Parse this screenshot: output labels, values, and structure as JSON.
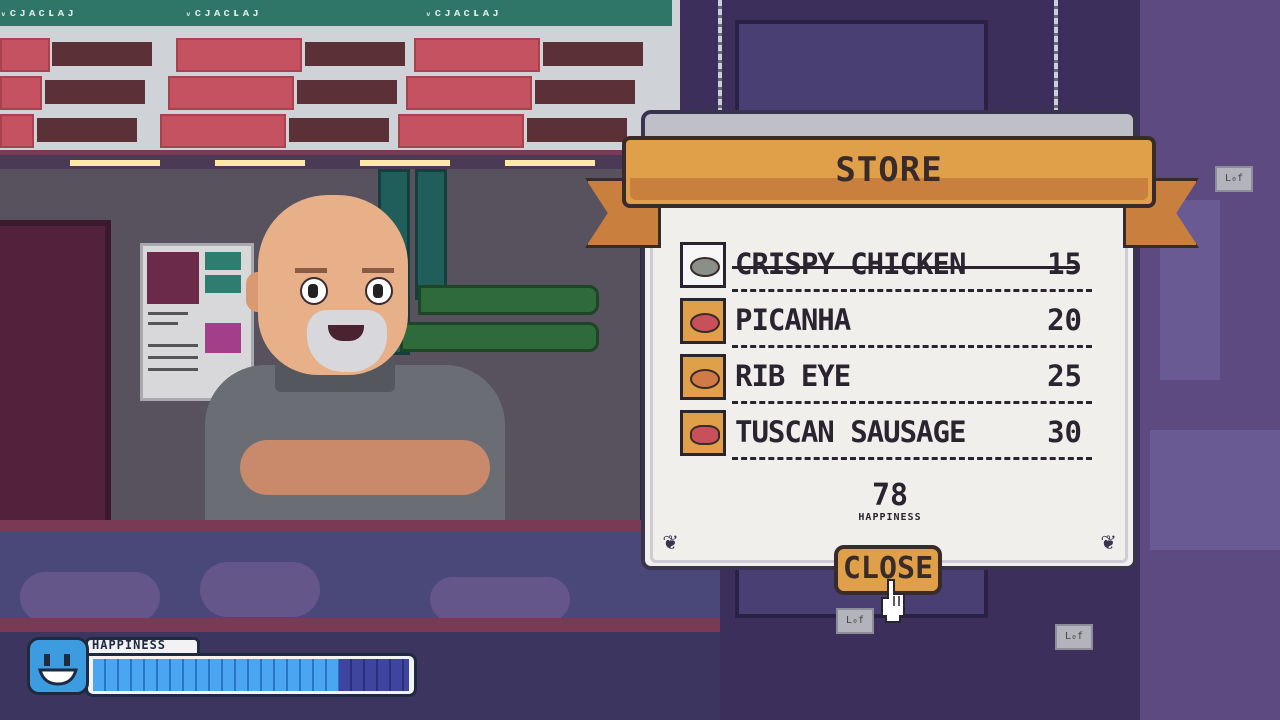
{
  "store": {
    "title": "STORE",
    "items": [
      {
        "name": "CRISPY CHICKEN",
        "price": "15",
        "purchased": true,
        "icon": "fried-chicken-icon",
        "food_color": "#8a8f8a"
      },
      {
        "name": "PICANHA",
        "price": "20",
        "purchased": false,
        "icon": "picanha-steak-icon",
        "food_color": "#c8505a"
      },
      {
        "name": "RIB EYE",
        "price": "25",
        "purchased": false,
        "icon": "rib-eye-steak-icon",
        "food_color": "#d07a45"
      },
      {
        "name": "TUSCAN SAUSAGE",
        "price": "30",
        "purchased": false,
        "icon": "tuscan-sausage-icon",
        "food_color": "#c8505a"
      }
    ],
    "happiness_value": "78",
    "happiness_caption": "HAPPINESS",
    "close_label": "CLOSE"
  },
  "hud": {
    "label": "HAPPINESS",
    "fill_fraction": 0.78,
    "face_icon": "smiling-face-icon"
  },
  "colors": {
    "banner": "#e0a04a",
    "panel": "#f1efec",
    "hud_fill": "#4aa6ee",
    "menu_board_header": "#2f7668",
    "menu_red": "#c45261"
  }
}
